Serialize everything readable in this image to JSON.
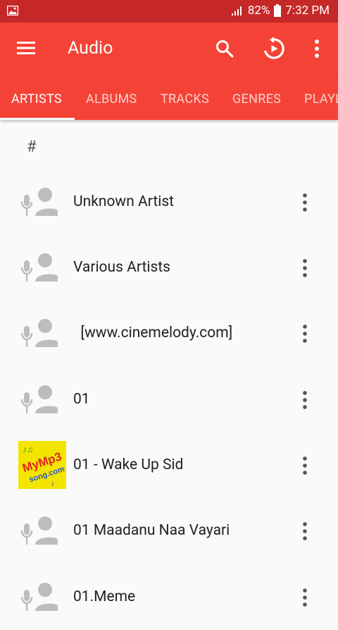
{
  "status": {
    "battery": "82%",
    "time": "7:32 PM"
  },
  "appbar": {
    "title": "Audio"
  },
  "tabs": [
    "ARTISTS",
    "ALBUMS",
    "TRACKS",
    "GENRES",
    "PLAYLISTS"
  ],
  "section_header": "#",
  "artists": [
    {
      "name": "Unknown Artist",
      "icon": "artist-placeholder-icon"
    },
    {
      "name": "Various Artists",
      "icon": "artist-placeholder-icon"
    },
    {
      "name": "  [www.cinemelody.com]",
      "icon": "artist-placeholder-icon"
    },
    {
      "name": "01",
      "icon": "artist-placeholder-icon"
    },
    {
      "name": "01 - Wake Up Sid",
      "icon": "album-art"
    },
    {
      "name": "01 Maadanu Naa Vayari",
      "icon": "artist-placeholder-icon"
    },
    {
      "name": "01.Meme",
      "icon": "artist-placeholder-icon"
    }
  ],
  "colors": {
    "primary": "#f44336",
    "status_bar": "#c62828",
    "placeholder": "#bdbdbd"
  }
}
